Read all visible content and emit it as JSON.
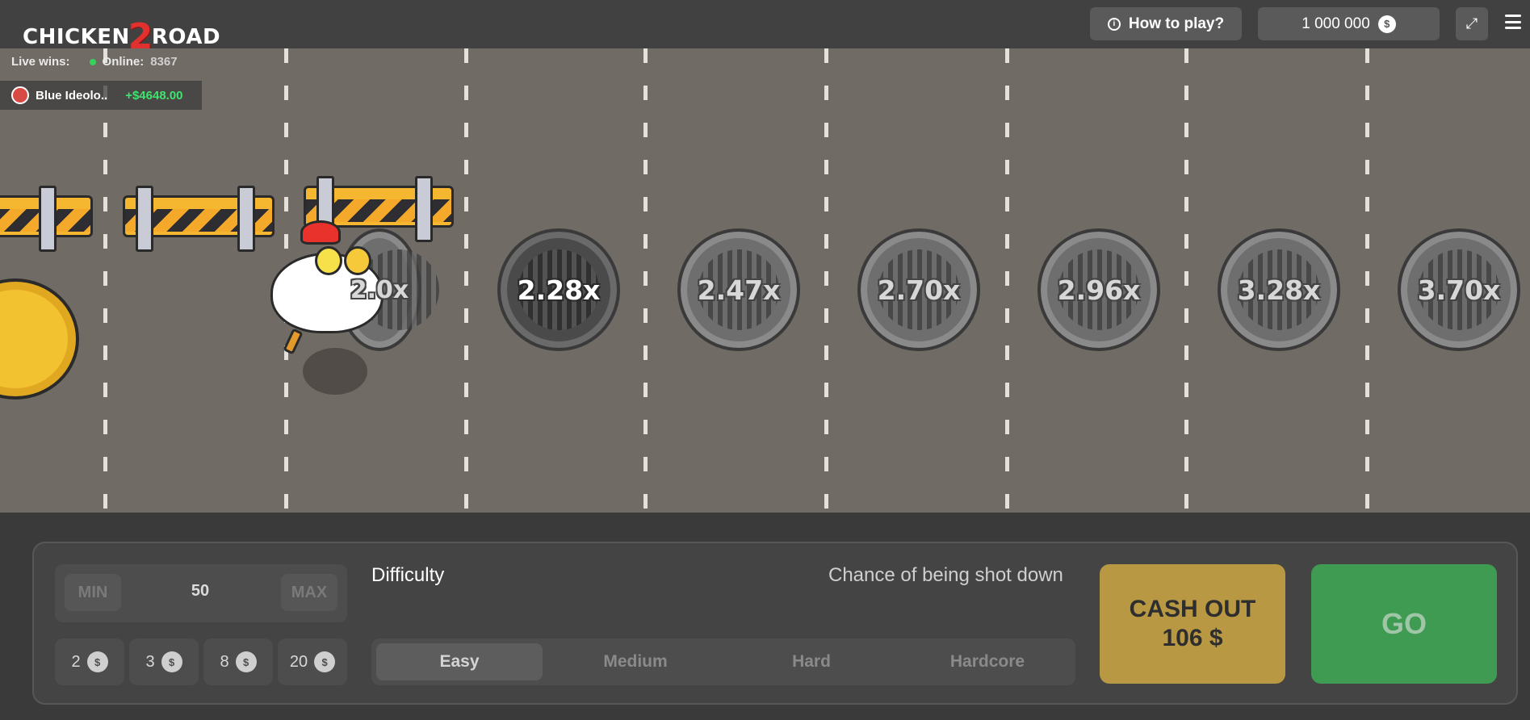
{
  "header": {
    "logo_text_1": "CHICKEN",
    "logo_text_2": "2",
    "logo_text_3": "ROAD",
    "how_to_play": "How to play?",
    "balance": "1 000 000",
    "currency_symbol": "$"
  },
  "live": {
    "live_wins_label": "Live wins:",
    "online_label": "Online:",
    "online_count": "8367",
    "recent_win": {
      "user": "Blue Ideolo..",
      "amount": "+$4648.00"
    }
  },
  "road": {
    "multipliers": [
      {
        "label": "2.0x",
        "state": "passed"
      },
      {
        "label": "2.28x",
        "state": "active"
      },
      {
        "label": "2.47x",
        "state": "upcoming"
      },
      {
        "label": "2.70x",
        "state": "upcoming"
      },
      {
        "label": "2.96x",
        "state": "upcoming"
      },
      {
        "label": "3.28x",
        "state": "upcoming"
      },
      {
        "label": "3.70x",
        "state": "upcoming"
      }
    ]
  },
  "controls": {
    "min_label": "MIN",
    "max_label": "MAX",
    "bet_value": "50",
    "quick_bets": [
      "2",
      "3",
      "8",
      "20"
    ],
    "difficulty_label": "Difficulty",
    "chance_label": "Chance of being shot down",
    "difficulties": [
      "Easy",
      "Medium",
      "Hard",
      "Hardcore"
    ],
    "selected_difficulty": "Easy",
    "cashout_line1": "CASH OUT",
    "cashout_line2": "106 $",
    "go_label": "GO"
  },
  "colors": {
    "road": "#716b66",
    "cashout": "#b89843",
    "go": "#3f9a52",
    "win_green": "#3fe36e"
  }
}
